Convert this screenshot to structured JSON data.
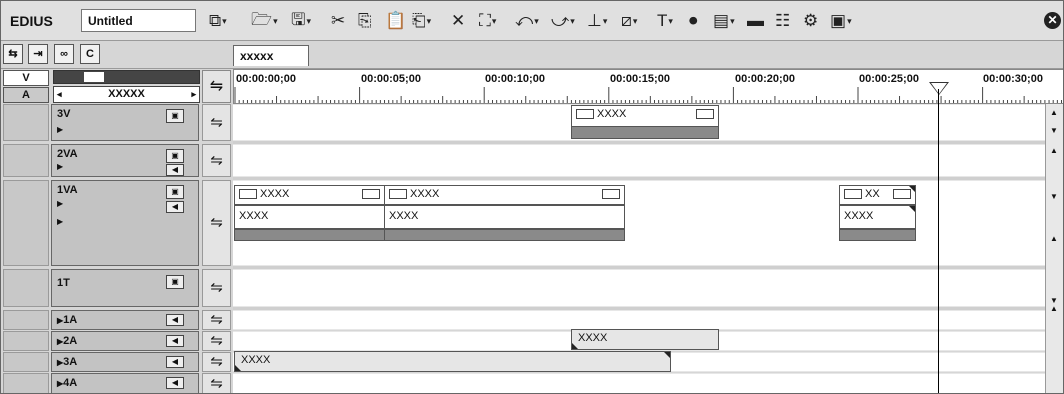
{
  "app": {
    "name": "EDIUS",
    "project": "Untitled"
  },
  "toolbar": {
    "icons": [
      "new-sequence-icon",
      "open-icon",
      "save-icon",
      "cut-icon",
      "copy-icon",
      "paste-icon",
      "insert-paste-icon",
      "delete-icon",
      "ripple-delete-icon",
      "undo-icon",
      "redo-icon",
      "mark-icon",
      "split-icon",
      "title-icon",
      "record-icon",
      "render-icon",
      "preview-icon",
      "mixer-icon",
      "settings-icon",
      "layout-icon",
      "close-icon"
    ]
  },
  "sequence_tab": "xxxxx",
  "track_controls": {
    "v_label": "V",
    "a_label": "A",
    "track_select": "XXXXX"
  },
  "ruler": {
    "timecodes": [
      "00:00:00;00",
      "00:00:05;00",
      "00:00:10;00",
      "00:00:15;00",
      "00:00:20;00",
      "00:00:25;00",
      "00:00:30;00"
    ]
  },
  "tracks": [
    {
      "name": "3V"
    },
    {
      "name": "2VA"
    },
    {
      "name": "1VA"
    },
    {
      "name": "1T"
    },
    {
      "name": "1A"
    },
    {
      "name": "2A"
    },
    {
      "name": "3A"
    },
    {
      "name": "4A"
    }
  ],
  "clips": {
    "v3": "XXXX",
    "va1_a": "XXXX",
    "va1_a_audio": "XXXX",
    "va1_b": "XXXX",
    "va1_b_audio": "XXXX",
    "va1_c": "XX",
    "va1_c_audio": "XXXX",
    "a2": "XXXX",
    "a3": "XXXX"
  }
}
